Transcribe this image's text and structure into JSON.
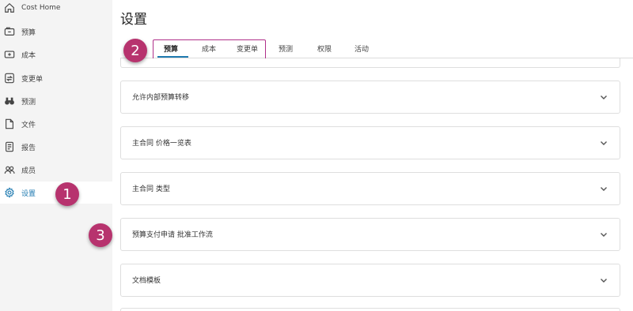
{
  "sidebar": {
    "items": [
      {
        "label": "Cost Home",
        "icon": "home-icon",
        "active": false
      },
      {
        "label": "预算",
        "icon": "budget-icon",
        "active": false
      },
      {
        "label": "成本",
        "icon": "cost-icon",
        "active": false
      },
      {
        "label": "变更单",
        "icon": "change-order-icon",
        "active": false
      },
      {
        "label": "预测",
        "icon": "forecast-binoculars-icon",
        "active": false
      },
      {
        "label": "文件",
        "icon": "file-icon",
        "active": false
      },
      {
        "label": "报告",
        "icon": "report-icon",
        "active": false
      },
      {
        "label": "成员",
        "icon": "members-icon",
        "active": false
      },
      {
        "label": "设置",
        "icon": "gear-icon",
        "active": true
      }
    ]
  },
  "header": {
    "title": "设置"
  },
  "tabs": [
    {
      "label": "预算",
      "active": true
    },
    {
      "label": "成本",
      "active": false
    },
    {
      "label": "变更单",
      "active": false
    },
    {
      "label": "预测",
      "active": false
    },
    {
      "label": "权限",
      "active": false
    },
    {
      "label": "活动",
      "active": false
    }
  ],
  "sections": [
    {
      "label": "允许内部预算转移"
    },
    {
      "label": "主合同 价格一览表"
    },
    {
      "label": "主合同 类型"
    },
    {
      "label": "预算支付申请 批准工作流"
    },
    {
      "label": "文档模板"
    }
  ],
  "callouts": [
    "1",
    "2",
    "3"
  ],
  "colors": {
    "accent": "#1f7ab0",
    "callout": "#b7336e",
    "highlight_border": "#b0308a"
  }
}
